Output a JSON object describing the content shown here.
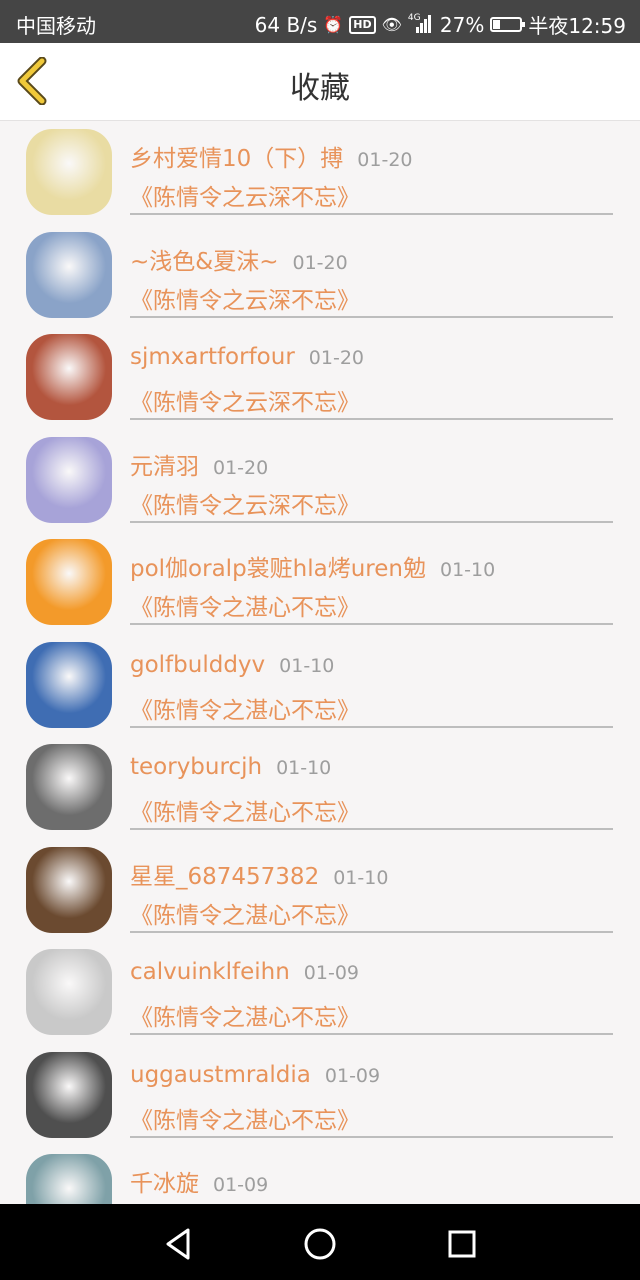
{
  "status_bar": {
    "carrier": "中国移动",
    "speed": "64 B/s",
    "network": "4G",
    "battery": "27%",
    "battery_level": 0.27,
    "time": "半夜12:59"
  },
  "header": {
    "title": "收藏"
  },
  "favorites": [
    {
      "name": "乡村爱情10（下）搏",
      "date": "01-20",
      "work": "《陈情令之云深不忘》",
      "avatar_color": "#e9dca3"
    },
    {
      "name": "~浅色&夏沫~",
      "date": "01-20",
      "work": "《陈情令之云深不忘》",
      "avatar_color": "#8aa3c8"
    },
    {
      "name": "sjmxartforfour",
      "date": "01-20",
      "work": "《陈情令之云深不忘》",
      "avatar_color": "#b3553e"
    },
    {
      "name": "元清羽",
      "date": "01-20",
      "work": "《陈情令之云深不忘》",
      "avatar_color": "#a7a3d8"
    },
    {
      "name": "pol伽oralp裳赃hla烤uren勉",
      "date": "01-10",
      "work": "《陈情令之湛心不忘》",
      "avatar_color": "#f39a2a"
    },
    {
      "name": "golfbulddyv",
      "date": "01-10",
      "work": "《陈情令之湛心不忘》",
      "avatar_color": "#3f6db3"
    },
    {
      "name": "teoryburcjh",
      "date": "01-10",
      "work": "《陈情令之湛心不忘》",
      "avatar_color": "#6d6d6d"
    },
    {
      "name": "星星_687457382",
      "date": "01-10",
      "work": "《陈情令之湛心不忘》",
      "avatar_color": "#6b4a30"
    },
    {
      "name": "calvuinklfeihn",
      "date": "01-09",
      "work": "《陈情令之湛心不忘》",
      "avatar_color": "#c9c9c9"
    },
    {
      "name": "uggaustmraldia",
      "date": "01-09",
      "work": "《陈情令之湛心不忘》",
      "avatar_color": "#4f4f4f"
    },
    {
      "name": "千冰旋",
      "date": "01-09",
      "work": "",
      "avatar_color": "#7fa1a8"
    }
  ],
  "nav_bar": {
    "back": "back-triangle",
    "home": "home-circle",
    "recents": "recents-square"
  }
}
